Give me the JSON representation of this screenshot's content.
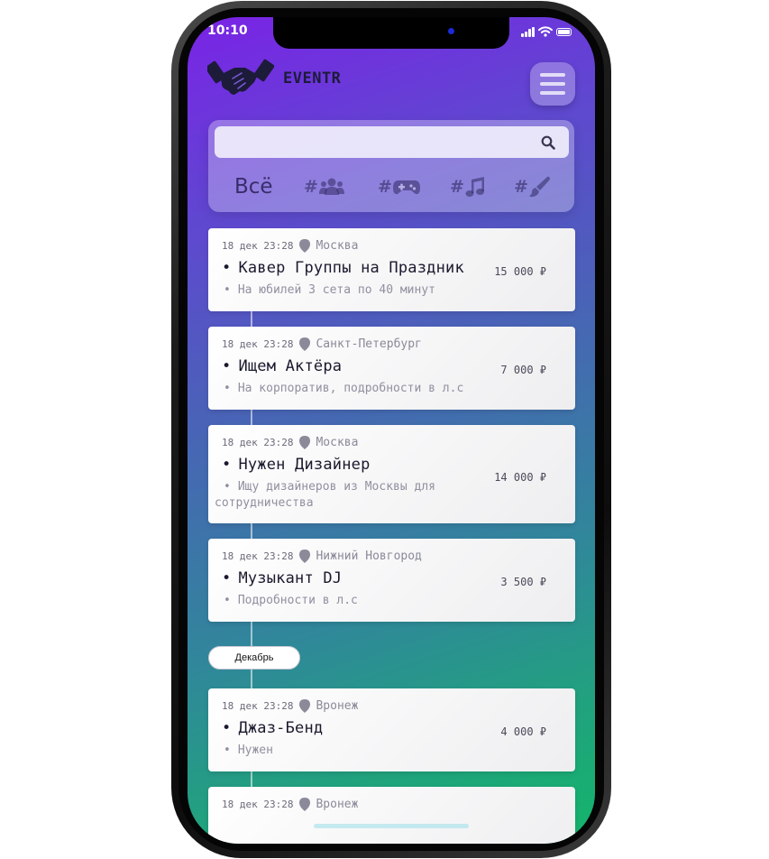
{
  "status": {
    "time": "10:10"
  },
  "brand": {
    "name": "EVENTR",
    "logo_icon": "handshake-icon"
  },
  "search": {
    "placeholder": "",
    "value": "",
    "icon": "search-icon"
  },
  "categories": [
    {
      "label": "Всё",
      "icon": ""
    },
    {
      "label": "#",
      "icon": "users-icon"
    },
    {
      "label": "#",
      "icon": "gamepad-icon"
    },
    {
      "label": "#",
      "icon": "music-icon"
    },
    {
      "label": "#",
      "icon": "paintbrush-icon"
    }
  ],
  "events": [
    {
      "date": "18 дек 23:28",
      "city": "Москва",
      "title": "Кавер Группы на Праздник",
      "description": "На юбилей 3 сета по 40 минут",
      "price": "15 000 ₽"
    },
    {
      "date": "18 дек 23:28",
      "city": "Санкт-Петербург",
      "title": "Ищем Актёра",
      "description": "На корпоратив, подробности в л.с",
      "price": "7 000 ₽"
    },
    {
      "date": "18 дек 23:28",
      "city": "Москва",
      "title": "Нужен Дизайнер",
      "description_line1": "Ищу дизайнеров из Москвы для",
      "description_line2": "сотрудничества",
      "price": "14 000 ₽"
    },
    {
      "date": "18 дек 23:28",
      "city": "Нижний Новгород",
      "title": "Музыкант DJ",
      "description": "Подробности в л.с",
      "price": "3 500 ₽"
    }
  ],
  "month_divider": "Декабрь",
  "events_december": [
    {
      "date": "18 дек 23:28",
      "city": "Вронеж",
      "title": "Джаз-Бенд",
      "description": "Нужен",
      "price": "4 000 ₽"
    },
    {
      "date": "18 дек 23:28",
      "city": "Вронеж"
    }
  ],
  "colors": {
    "gradient_top": "#7a23e6",
    "gradient_bottom": "#13b56a",
    "card": "#ffffff"
  }
}
